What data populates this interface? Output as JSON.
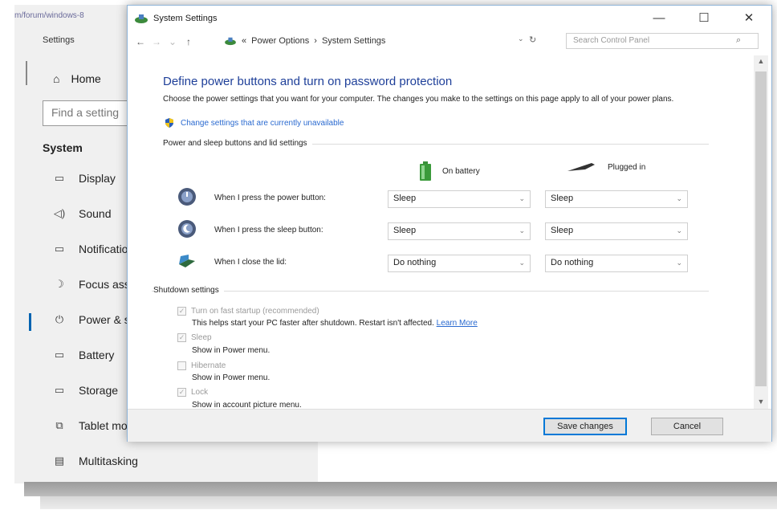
{
  "background_app": {
    "url_text": "m/forum/windows-8",
    "title": "Settings",
    "home": "Home",
    "find_placeholder": "Find a setting",
    "system": "System",
    "nav_items": [
      {
        "icon": "display-icon",
        "label": "Display"
      },
      {
        "icon": "sound-icon",
        "label": "Sound"
      },
      {
        "icon": "notifications-icon",
        "label": "Notificatio"
      },
      {
        "icon": "focus-assist-icon",
        "label": "Focus assis"
      },
      {
        "icon": "power-icon",
        "label": "Power & sl"
      },
      {
        "icon": "battery-icon",
        "label": "Battery"
      },
      {
        "icon": "storage-icon",
        "label": "Storage"
      },
      {
        "icon": "tablet-mode-icon",
        "label": "Tablet moc"
      },
      {
        "icon": "multitasking-icon",
        "label": "Multitasking"
      }
    ]
  },
  "window": {
    "title": "System Settings",
    "controls": {
      "minimize": "—",
      "maximize": "☐",
      "close": "✕"
    }
  },
  "address_bar": {
    "breadcrumb_prefix": "«",
    "crumb_1": "Power Options",
    "separator": "›",
    "crumb_2": "System Settings",
    "search_placeholder": "Search Control Panel"
  },
  "main": {
    "heading": "Define power buttons and turn on password protection",
    "description": "Choose the power settings that you want for your computer. The changes you make to the settings on this page apply to all of your power plans.",
    "change_link": "Change settings that are currently unavailable",
    "power_group_title": "Power and sleep buttons and lid settings",
    "col_battery": "On battery",
    "col_plugged": "Plugged in",
    "rows": [
      {
        "label": "When I press the power button:",
        "battery": "Sleep",
        "plugged": "Sleep"
      },
      {
        "label": "When I press the sleep button:",
        "battery": "Sleep",
        "plugged": "Sleep"
      },
      {
        "label": "When I close the lid:",
        "battery": "Do nothing",
        "plugged": "Do nothing"
      }
    ],
    "shutdown_group_title": "Shutdown settings",
    "shutdown": [
      {
        "label": "Turn on fast startup (recommended)",
        "checked": true,
        "sub": "This helps start your PC faster after shutdown. Restart isn't affected.",
        "link": "Learn More"
      },
      {
        "label": "Sleep",
        "checked": true,
        "sub": "Show in Power menu."
      },
      {
        "label": "Hibernate",
        "checked": false,
        "sub": "Show in Power menu."
      },
      {
        "label": "Lock",
        "checked": true,
        "sub": "Show in account picture menu."
      }
    ]
  },
  "footer": {
    "save": "Save changes",
    "cancel": "Cancel"
  }
}
